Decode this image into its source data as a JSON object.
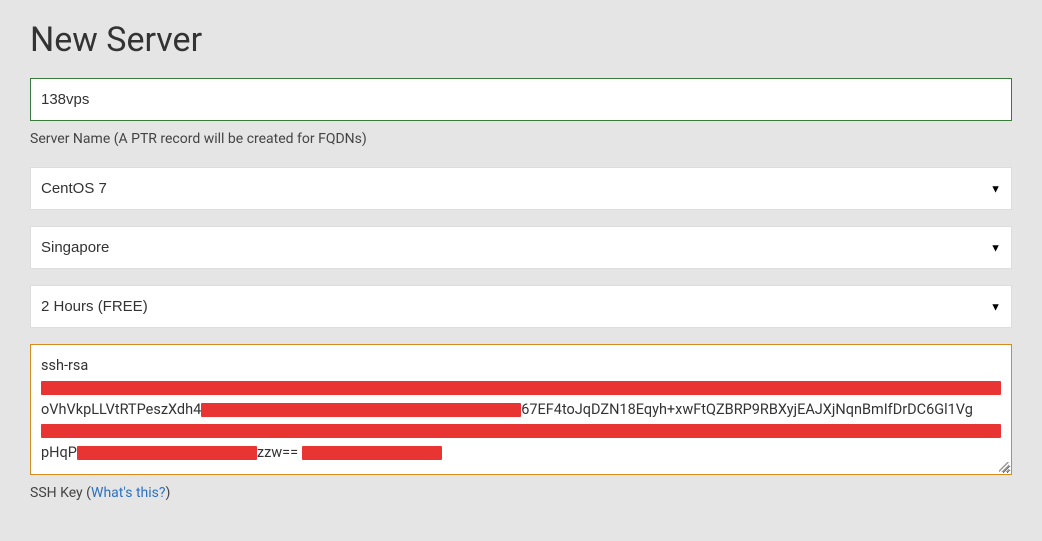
{
  "page": {
    "title": "New Server"
  },
  "serverName": {
    "value": "138vps",
    "help": "Server Name (A PTR record will be created for FQDNs)"
  },
  "os": {
    "selected": "CentOS 7"
  },
  "region": {
    "selected": "Singapore"
  },
  "duration": {
    "selected": "2 Hours (FREE)"
  },
  "sshKey": {
    "line1": "ssh-rsa",
    "mid_prefix": "oVhVkpLLVtRTPeszXdh4",
    "mid_mid": "67EF4toJqDZN18Eqyh+xwFtQZBRP9RBXyjEAJXjNqnBmIfDrDC6Gl1Vg",
    "end_prefix": "pHqP",
    "end_suffix": "zzw==",
    "label_prefix": "SSH Key (",
    "label_link": "What's this?",
    "label_suffix": ")"
  }
}
